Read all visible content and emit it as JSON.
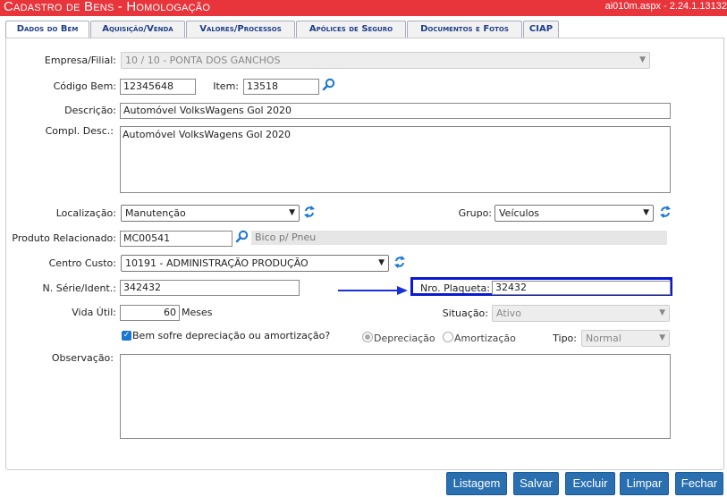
{
  "title": "Cadastro de Bens  - Homologação",
  "page_info": "ai010m.aspx - 2.24.1.13132",
  "tabs": [
    {
      "label": "Dados do Bem"
    },
    {
      "label": "Aquisição/Venda"
    },
    {
      "label": "Valores/Processos"
    },
    {
      "label": "Apólices de Seguro"
    },
    {
      "label": "Documentos e Fotos"
    },
    {
      "label": "CIAP"
    }
  ],
  "form": {
    "empresa_label": "Empresa/Filial:",
    "empresa_value": "10 / 10 - PONTA DOS GANCHOS",
    "codigo_label": "Código Bem:",
    "codigo_value": "12345648",
    "item_label": "Item:",
    "item_value": "13518",
    "descricao_label": "Descrição:",
    "descricao_value": "Automóvel VolksWagens Gol 2020",
    "compl_label": "Compl. Desc.:",
    "compl_value": "Automóvel VolksWagens Gol 2020",
    "localizacao_label": "Localização:",
    "localizacao_value": "Manutenção",
    "grupo_label": "Grupo:",
    "grupo_value": "Veículos",
    "produto_label": "Produto Relacionado:",
    "produto_value": "MC00541",
    "produto_desc": "Bico p/ Pneu",
    "centro_label": "Centro Custo:",
    "centro_value": "10191 - ADMINISTRAÇÃO PRODUÇÃO",
    "serie_label": "N. Série/Ident.:",
    "serie_value": "342432",
    "plaqueta_label": "Nro. Plaqueta:",
    "plaqueta_value": "32432",
    "vida_label": "Vida Útil:",
    "vida_value": "60",
    "vida_unit": "Meses",
    "situacao_label": "Situação:",
    "situacao_value": "Ativo",
    "depreciacao_check_label": "Bem sofre depreciação ou amortização?",
    "depreciacao_checked": true,
    "radio_depreciacao": "Depreciação",
    "radio_amortizacao": "Amortização",
    "tipo_label": "Tipo:",
    "tipo_value": "Normal",
    "observacao_label": "Observação:",
    "observacao_value": ""
  },
  "buttons": {
    "listagem": "Listagem",
    "salvar": "Salvar",
    "excluir": "Excluir",
    "limpar": "Limpar",
    "fechar": "Fechar"
  },
  "colors": {
    "titlebar": "#e8343b",
    "button": "#2a6fb0",
    "highlight": "#0a1ad0",
    "arrow": "#1a2fd8"
  }
}
